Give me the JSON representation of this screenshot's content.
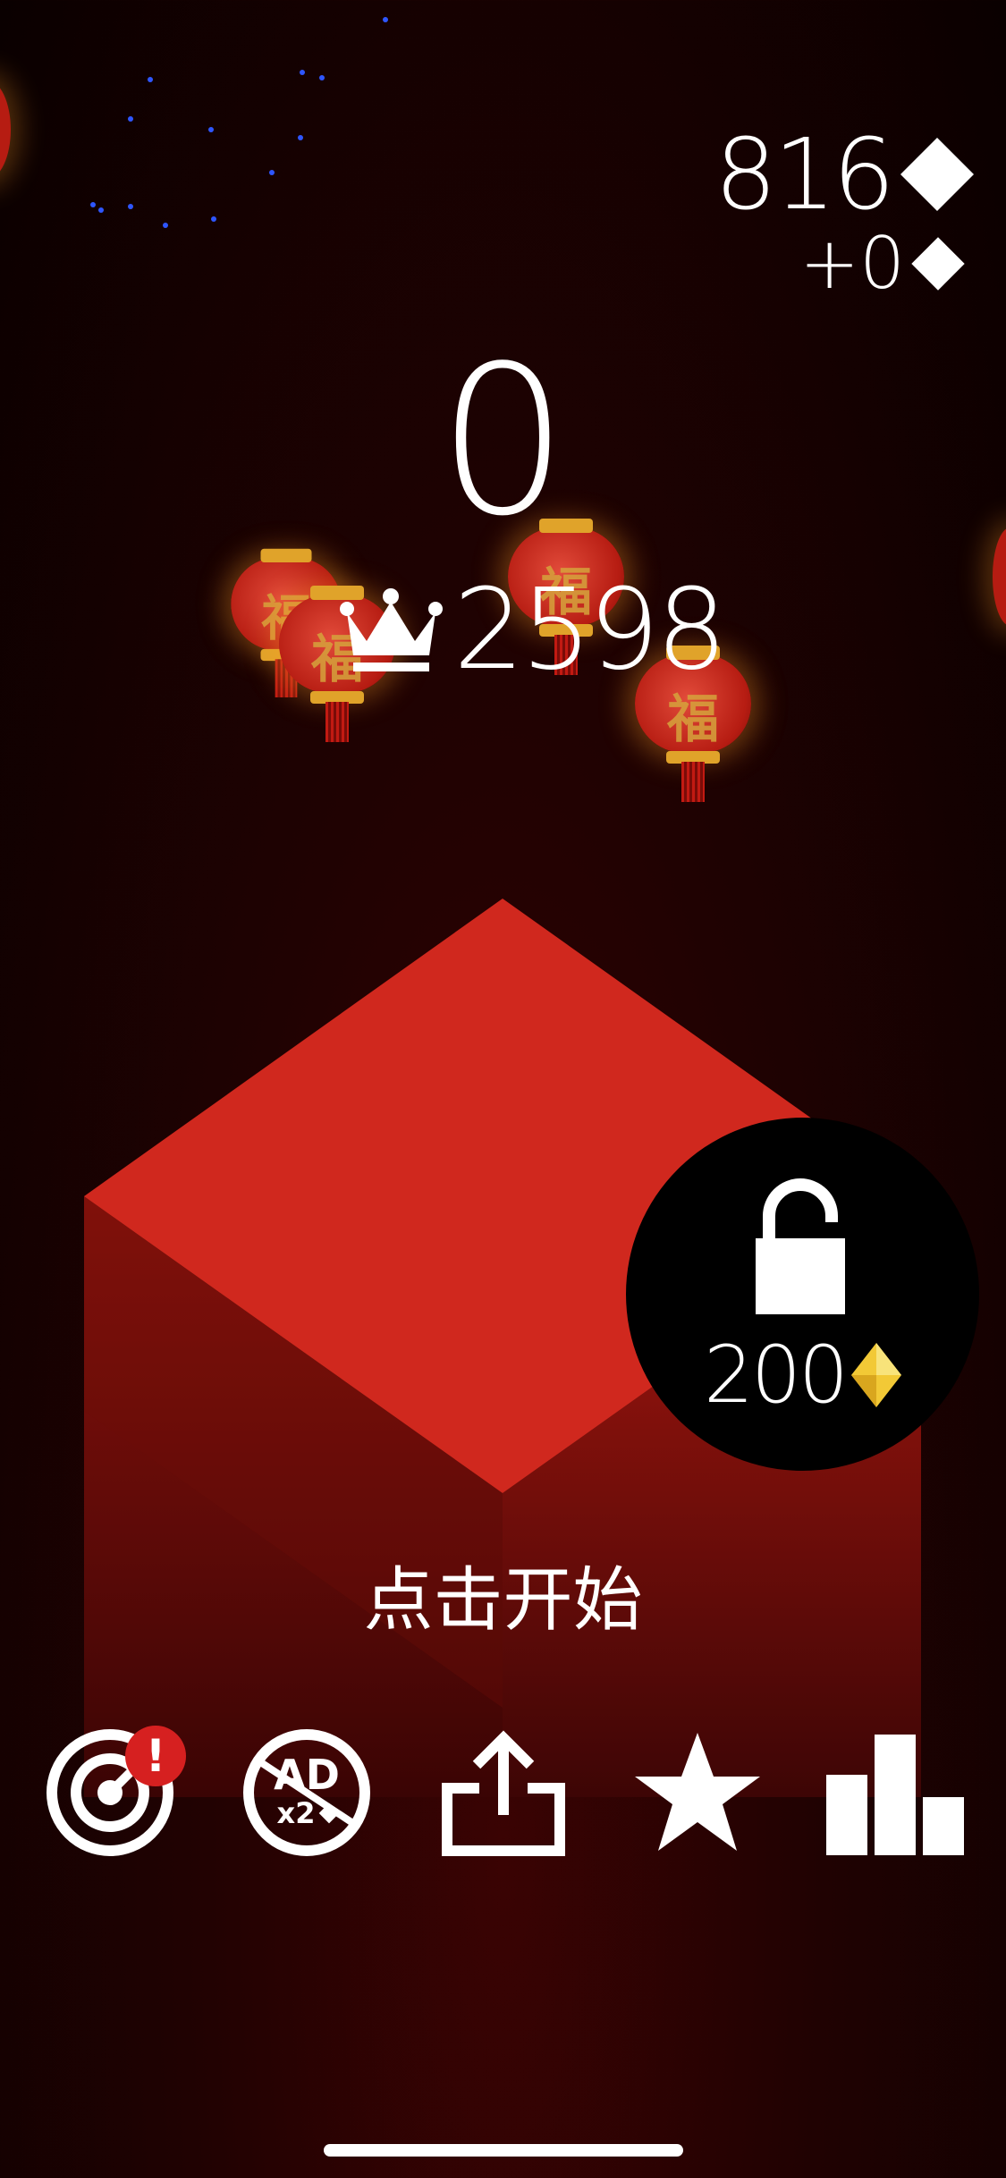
{
  "hud": {
    "gems_total": "816",
    "gems_gain": "+0"
  },
  "score": {
    "current": "0",
    "best": "2598"
  },
  "lantern_char": "福",
  "unlock": {
    "cost": "200"
  },
  "start_prompt": "点击开始",
  "bottom_bar": {
    "ad_label": "AD",
    "ad_multiplier": "x2",
    "notification": "!"
  },
  "icons": {
    "gem": "diamond-icon",
    "crown": "crown-icon",
    "lock": "unlock-icon",
    "missions": "target-icon",
    "remove_ads": "no-ads-icon",
    "share": "share-icon",
    "rate": "star-icon",
    "leaderboard": "leaderboard-icon"
  },
  "colors": {
    "cube_top": "#d0281e",
    "cube_left": "#8b120c",
    "cube_right": "#a8170f",
    "gold": "#f2c936"
  }
}
